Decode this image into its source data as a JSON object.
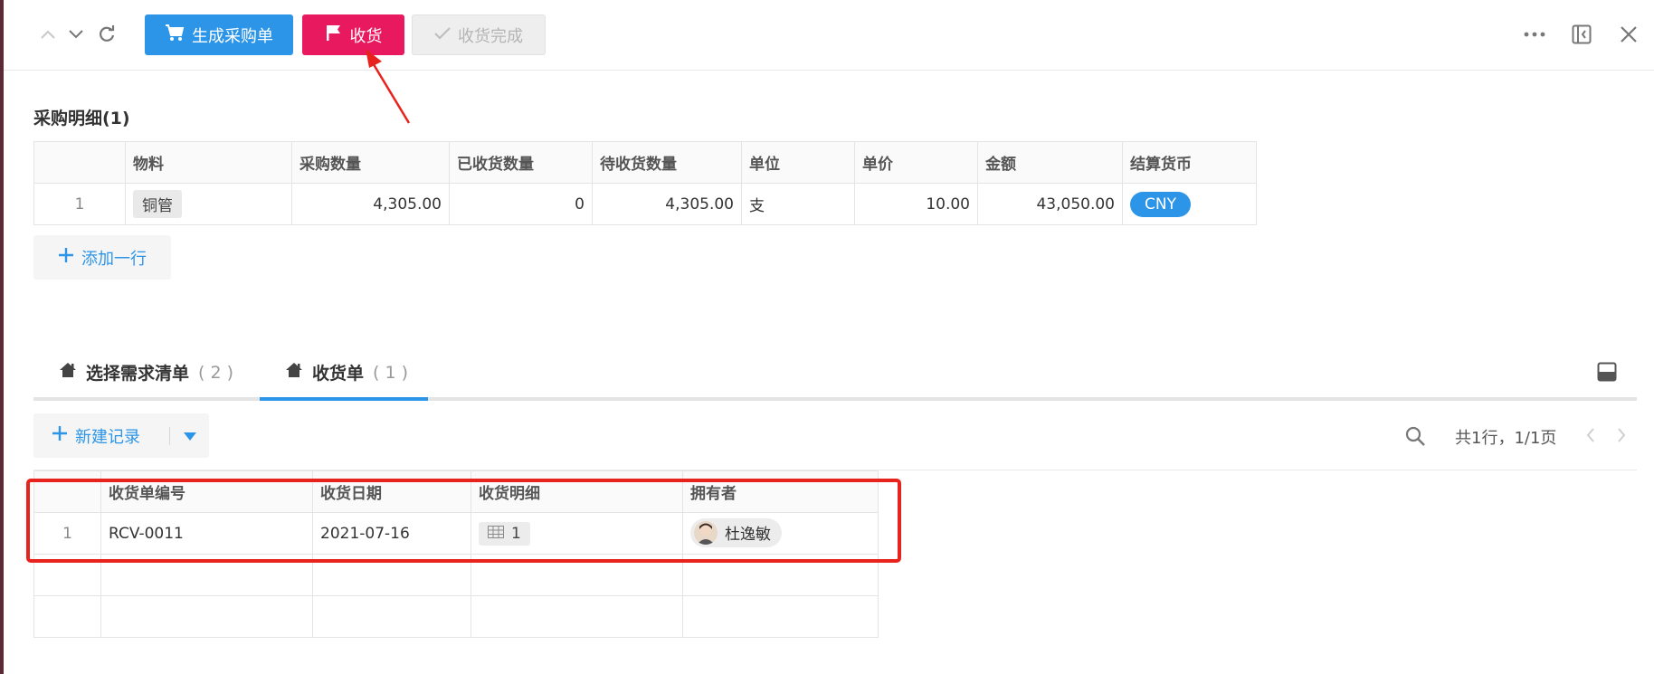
{
  "toolbar": {
    "generate_po_label": "生成采购单",
    "receive_label": "收货",
    "receive_done_label": "收货完成",
    "colors": {
      "blue": "#2d95e8",
      "pink": "#e8195e"
    }
  },
  "purchase_detail": {
    "title": "采购明细(1)",
    "columns": [
      "物料",
      "采购数量",
      "已收货数量",
      "待收货数量",
      "单位",
      "单价",
      "金额",
      "结算货币"
    ],
    "rows": [
      {
        "index": "1",
        "material": "铜管",
        "qty": "4,305.00",
        "received": "0",
        "pending": "4,305.00",
        "unit": "支",
        "price": "10.00",
        "amount": "43,050.00",
        "currency": "CNY"
      }
    ],
    "add_row_label": "添加一行"
  },
  "tabs": [
    {
      "label": "选择需求清单",
      "count": "( 2 )"
    },
    {
      "label": "收货单",
      "count": "( 1 )"
    }
  ],
  "records": {
    "new_record_label": "新建记录",
    "pager": "共1行，1/1页",
    "columns": [
      "收货单编号",
      "收货日期",
      "收货明细",
      "拥有者"
    ],
    "rows": [
      {
        "index": "1",
        "code": "RCV-0011",
        "date": "2021-07-16",
        "detail_count": "1",
        "owner": "杜逸敏"
      }
    ]
  },
  "annotation_colors": {
    "highlight": "#e8221c"
  }
}
